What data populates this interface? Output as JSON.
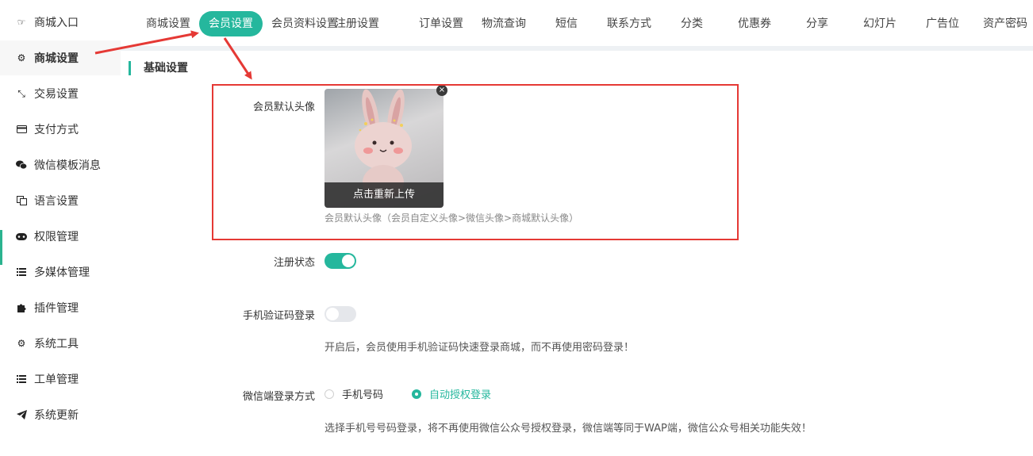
{
  "sidebar": {
    "items": [
      {
        "label": "商城入口",
        "icon": "hand-point-icon"
      },
      {
        "label": "商城设置",
        "icon": "gear-icon"
      },
      {
        "label": "交易设置",
        "icon": "compress-arrows-icon"
      },
      {
        "label": "支付方式",
        "icon": "credit-card-icon"
      },
      {
        "label": "微信模板消息",
        "icon": "wechat-icon"
      },
      {
        "label": "语言设置",
        "icon": "language-icon"
      },
      {
        "label": "权限管理",
        "icon": "gamepad-icon"
      },
      {
        "label": "多媒体管理",
        "icon": "list-icon"
      },
      {
        "label": "插件管理",
        "icon": "puzzle-icon"
      },
      {
        "label": "系统工具",
        "icon": "gear-icon"
      },
      {
        "label": "工单管理",
        "icon": "list-icon"
      },
      {
        "label": "系统更新",
        "icon": "paper-plane-icon"
      }
    ]
  },
  "tabs": [
    "商城设置",
    "会员设置",
    "会员资料设置",
    "注册设置",
    "订单设置",
    "物流查询",
    "短信",
    "联系方式",
    "分类",
    "优惠券",
    "分享",
    "幻灯片",
    "广告位",
    "资产密码"
  ],
  "section": {
    "title": "基础设置"
  },
  "avatar": {
    "label": "会员默认头像",
    "reupload": "点击重新上传",
    "close": "×",
    "hint": "会员默认头像（会员自定义头像>微信头像>商城默认头像）"
  },
  "register_status": {
    "label": "注册状态",
    "on": true
  },
  "sms_login": {
    "label": "手机验证码登录",
    "on": false,
    "hint": "开启后，会员使用手机验证码快速登录商城，而不再使用密码登录！"
  },
  "wechat_login": {
    "label": "微信端登录方式",
    "options": [
      "手机号码",
      "自动授权登录"
    ],
    "selected": "自动授权登录",
    "hint": "选择手机号号码登录，将不再使用微信公众号授权登录，微信端等同于WAP端，微信公众号相关功能失效！"
  },
  "colors": {
    "accent": "#25b79d",
    "annotation": "#e53935"
  }
}
